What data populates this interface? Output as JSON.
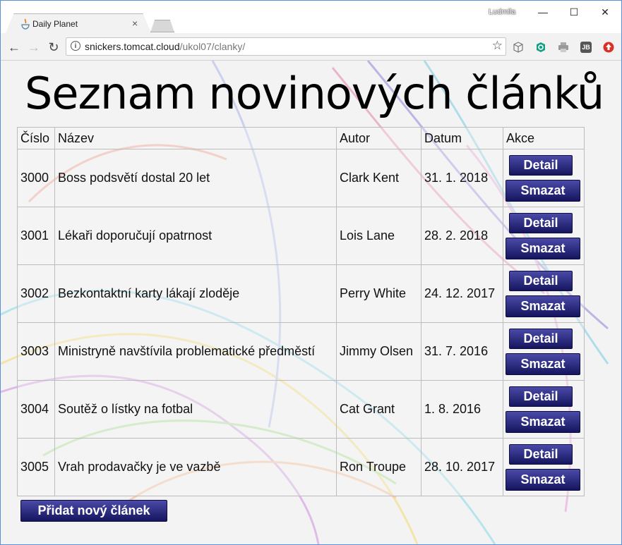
{
  "browser": {
    "tab_title": "Daily Planet",
    "tab_close": "×",
    "user_name": "Ludmila",
    "window_controls": {
      "minimize": "—",
      "maximize": "☐",
      "close": "✕"
    },
    "nav": {
      "back": "←",
      "forward": "→",
      "reload": "↻"
    },
    "url_host": "snickers.tomcat.cloud",
    "url_path": "/ukol07/clanky/",
    "bookmark_star": "☆",
    "info_icon": "i",
    "extensions": [
      "cube-icon",
      "green-shield-icon",
      "printer-icon",
      "jb-icon",
      "red-upload-icon"
    ],
    "ext_jb_label": "JB"
  },
  "page": {
    "heading": "Seznam novinových článků",
    "table": {
      "headers": [
        "Číslo",
        "Název",
        "Autor",
        "Datum",
        "Akce"
      ],
      "rows": [
        {
          "num": "3000",
          "title": "Boss podsvětí dostal 20 let",
          "author": "Clark Kent",
          "date": "31. 1. 2018"
        },
        {
          "num": "3001",
          "title": "Lékaři doporučují opatrnost",
          "author": "Lois Lane",
          "date": "28. 2. 2018"
        },
        {
          "num": "3002",
          "title": "Bezkontaktní karty lákají zloděje",
          "author": "Perry White",
          "date": "24. 12. 2017"
        },
        {
          "num": "3003",
          "title": "Ministryně navštívila problematické předměstí",
          "author": "Jimmy Olsen",
          "date": "31. 7. 2016"
        },
        {
          "num": "3004",
          "title": "Soutěž o lístky na fotbal",
          "author": "Cat Grant",
          "date": "1. 8. 2016"
        },
        {
          "num": "3005",
          "title": "Vrah prodavačky je ve vazbě",
          "author": "Ron Troupe",
          "date": "28. 10. 2017"
        }
      ],
      "detail_label": "Detail",
      "delete_label": "Smazat"
    },
    "add_button": "Přidat nový článek"
  },
  "colors": {
    "button_top": "#4a4aa8",
    "button_bottom": "#15155e",
    "window_border": "#5b8fd6"
  }
}
